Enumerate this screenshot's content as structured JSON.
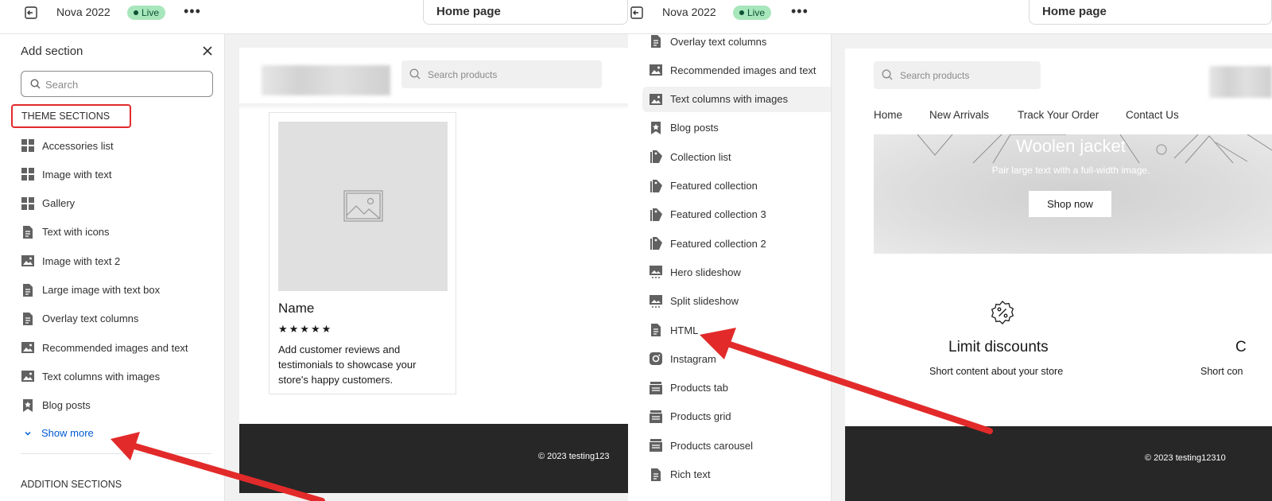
{
  "left": {
    "topbar": {
      "store_name": "Nova 2022",
      "status": "Live",
      "more": "•••",
      "page": "Home page"
    },
    "sidebar": {
      "title": "Add section",
      "search_placeholder": "Search",
      "theme_header": "THEME SECTIONS",
      "items": [
        {
          "label": "Accessories list",
          "icon": "grid-icon"
        },
        {
          "label": "Image with text",
          "icon": "grid-icon"
        },
        {
          "label": "Gallery",
          "icon": "grid-icon"
        },
        {
          "label": "Text with icons",
          "icon": "document-icon"
        },
        {
          "label": "Image with text 2",
          "icon": "image-icon"
        },
        {
          "label": "Large image with text box",
          "icon": "document-icon"
        },
        {
          "label": "Overlay text columns",
          "icon": "document-icon"
        },
        {
          "label": "Recommended images and text",
          "icon": "image-icon"
        },
        {
          "label": "Text columns with images",
          "icon": "image-icon"
        },
        {
          "label": "Blog posts",
          "icon": "star-bookmark-icon"
        }
      ],
      "show_more": "Show more",
      "addition_header": "ADDITION SECTIONS"
    },
    "preview": {
      "search_placeholder": "Search products",
      "card": {
        "name": "Name",
        "stars": "★★★★★",
        "text": "Add customer reviews and testimonials to showcase your store's happy customers."
      },
      "footer": "© 2023 testing123"
    }
  },
  "right": {
    "topbar": {
      "store_name": "Nova 2022",
      "status": "Live",
      "more": "•••",
      "page": "Home page"
    },
    "sidebar": {
      "items": [
        {
          "label": "Overlay text columns",
          "icon": "document-icon"
        },
        {
          "label": "Recommended images and text",
          "icon": "image-icon"
        },
        {
          "label": "Text columns with images",
          "icon": "image-icon",
          "highlighted": true
        },
        {
          "label": "Blog posts",
          "icon": "star-bookmark-icon"
        },
        {
          "label": "Collection list",
          "icon": "tag-icon"
        },
        {
          "label": "Featured collection",
          "icon": "tag-icon"
        },
        {
          "label": "Featured collection 3",
          "icon": "tag-icon"
        },
        {
          "label": "Featured collection 2",
          "icon": "tag-icon"
        },
        {
          "label": "Hero slideshow",
          "icon": "slideshow-icon"
        },
        {
          "label": "Split slideshow",
          "icon": "slideshow-icon"
        },
        {
          "label": "HTML",
          "icon": "document-icon"
        },
        {
          "label": "Instagram",
          "icon": "instagram-icon"
        },
        {
          "label": "Products tab",
          "icon": "product-stack-icon"
        },
        {
          "label": "Products grid",
          "icon": "product-stack-icon"
        },
        {
          "label": "Products carousel",
          "icon": "product-stack-icon"
        },
        {
          "label": "Rich text",
          "icon": "document-icon"
        }
      ]
    },
    "preview": {
      "search_placeholder": "Search products",
      "nav": [
        "Home",
        "New Arrivals",
        "Track Your Order",
        "Contact Us"
      ],
      "hero": {
        "title": "Woolen jacket",
        "subtitle": "Pair large text with a full-width image.",
        "button": "Shop now"
      },
      "feature": {
        "title": "Limit discounts",
        "text": "Short content about your store",
        "title_2": "C",
        "text_2": "Short con"
      },
      "footer": "© 2023 testing12310"
    }
  },
  "colors": {
    "annotation_red": "#e22a2a",
    "live_badge": "#a8e6bc",
    "link_blue": "#005bd3",
    "footer_dark": "#272727"
  }
}
